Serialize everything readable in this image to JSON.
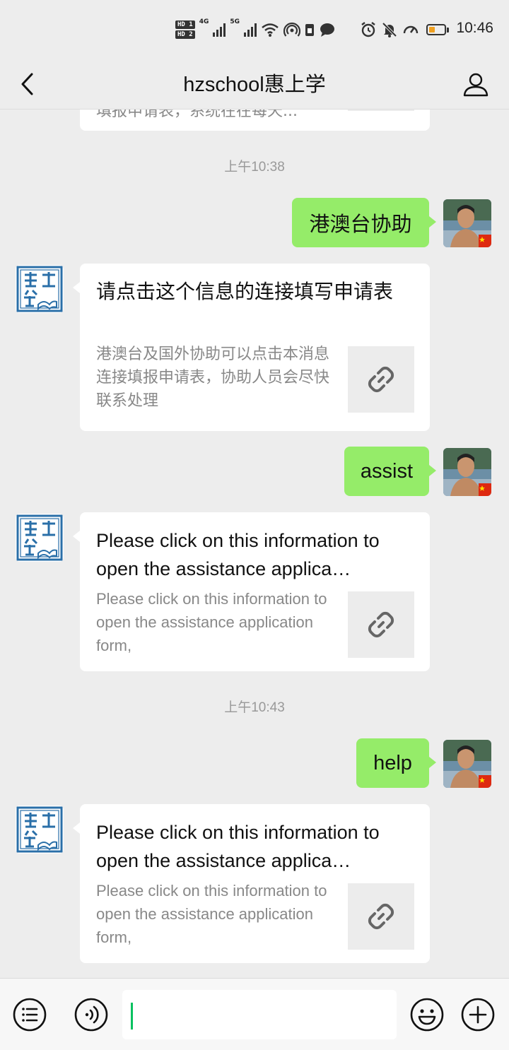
{
  "status_bar": {
    "time": "10:46",
    "hd1": "HD 1",
    "hd2": "HD 2",
    "net1": "4G",
    "net2": "5G",
    "battery_level": 0.2,
    "battery_color": "#f0a020"
  },
  "header": {
    "title": "hzschool惠上学",
    "back_icon": "chevron-left-icon",
    "profile_icon": "person-icon"
  },
  "messages": {
    "partial_card_text": "填报申请表，系统在在每天...",
    "time1": "上午10:38",
    "m1": {
      "text": "港澳台协助"
    },
    "c1": {
      "title": "请点击这个信息的连接填写申请表",
      "desc": "港澳台及国外协助可以点击本消息连接填报申请表，协助人员会尽快联系处理"
    },
    "m2": {
      "text": "assist"
    },
    "c2": {
      "title": "Please click on this information to open the assistance applica…",
      "desc": "Please click on this information to open the assistance application form,"
    },
    "time2": "上午10:43",
    "m3": {
      "text": "help"
    },
    "c3": {
      "title": "Please click on this information to open the assistance applica…",
      "desc": "Please click on this information to open the assistance application form,"
    }
  },
  "input_bar": {
    "menu_icon": "list-menu-icon",
    "voice_icon": "voice-icon",
    "emoji_icon": "emoji-icon",
    "plus_icon": "plus-icon",
    "input_value": ""
  },
  "colors": {
    "background": "#ededed",
    "sent_bubble": "#95ec69",
    "card": "#ffffff",
    "accent": "#07c160",
    "logo_blue": "#2a6fa8"
  }
}
